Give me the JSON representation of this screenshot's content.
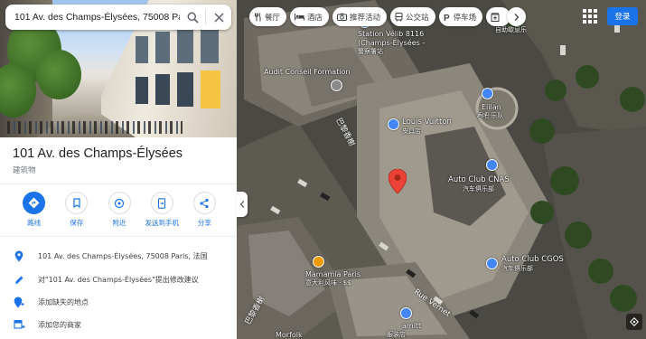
{
  "search": {
    "value": "101 Av. des Champs-Élysées, 75008 Pa"
  },
  "place": {
    "title": "101 Av. des Champs-Élysées",
    "type": "建筑物"
  },
  "actions": [
    {
      "label": "路线",
      "icon": "directions-icon"
    },
    {
      "label": "保存",
      "icon": "bookmark-icon"
    },
    {
      "label": "附近",
      "icon": "nearby-icon"
    },
    {
      "label": "发送到手机",
      "icon": "send-to-phone-icon"
    },
    {
      "label": "分享",
      "icon": "share-icon"
    }
  ],
  "info": [
    {
      "text": "101 Av. des Champs-Élysées, 75008 Paris, 法国",
      "icon": "location-pin-icon"
    },
    {
      "text": "对\"101 Av. des Champs-Élysées\"提出修改建议",
      "icon": "edit-pencil-icon"
    },
    {
      "text": "添加缺失的地点",
      "icon": "add-place-icon"
    },
    {
      "text": "添加您的商家",
      "icon": "add-business-icon"
    }
  ],
  "chips": [
    {
      "label": "餐厅",
      "icon": "restaurant-icon"
    },
    {
      "label": "酒店",
      "icon": "hotel-icon"
    },
    {
      "label": "推荐活动",
      "icon": "camera-icon"
    },
    {
      "label": "公交站",
      "icon": "transit-icon"
    },
    {
      "label": "停车场",
      "icon": "parking-icon"
    },
    {
      "label": "",
      "icon": "pharmacy-icon"
    }
  ],
  "header": {
    "signin": "登录"
  },
  "map": {
    "labels": {
      "station_velib": "Station Vélib 8116",
      "station_velib_2": "(Champs-Élysées -",
      "station_velib_3": "警察署站",
      "station_velib_top": "自助歇息乐",
      "audit_conseil": "Audit Conseil Formation",
      "louis_vuitton": "Louis Vuitton",
      "louis_vuitton_sub": "皮具店",
      "elilan": "Elilan",
      "elilan_sub": "酒吧·乐队",
      "auto_club_cnas": "Auto Club CNAS",
      "auto_club_cnas_sub": "汽车俱乐部",
      "auto_club_cgos": "Auto Club CGOS",
      "auto_club_cgos_sub": "汽车俱乐部",
      "mamamia": "Mamamia Paris",
      "mamamia_sub": "意大利风味 · $$",
      "amitt": "amitt",
      "amitt_sub": "服装店",
      "morfolk": "Morfolk",
      "road_champs": "巴黎香榭",
      "road_vernet": "Rue Vernet",
      "road_bottom": "巴黎香榭"
    }
  },
  "colors": {
    "accent": "#1a73e8",
    "pin": "#ea4335",
    "poi_blue": "#4285f4",
    "poi_orange": "#f29900",
    "poi_teal": "#12b5cb"
  }
}
